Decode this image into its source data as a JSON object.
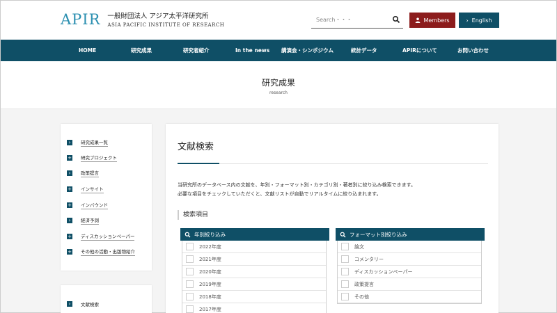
{
  "header": {
    "logo_mark": "APIR",
    "logo_jp": "一般財団法人 アジア太平洋研究所",
    "logo_en": "ASIA PACIFIC INSTITUTE OF RESEARCH",
    "search_placeholder": "Search・・・",
    "members_label": "Members",
    "english_label": "English"
  },
  "nav": {
    "items": [
      "HOME",
      "研究成果",
      "研究者紹介",
      "In the news",
      "講演会・シンポジウム",
      "統計データ",
      "APIRについて",
      "お問い合わせ"
    ]
  },
  "page": {
    "title": "研究成果",
    "subtitle": "research"
  },
  "sidebar": {
    "items": [
      {
        "label": "研究成果一覧",
        "icon": "›"
      },
      {
        "label": "研究プロジェクト",
        "icon": "+"
      },
      {
        "label": "政策提言",
        "icon": "›"
      },
      {
        "label": "インサイト",
        "icon": "+"
      },
      {
        "label": "インバウンド",
        "icon": "+"
      },
      {
        "label": "経済予測",
        "icon": "›"
      },
      {
        "label": "ディスカッションペーパー",
        "icon": "+"
      },
      {
        "label": "その他の活動・出版物紹介",
        "icon": "+"
      }
    ],
    "second_items": [
      {
        "label": "文献検索",
        "icon": "›"
      }
    ]
  },
  "main": {
    "title": "文献検索",
    "desc_line1": "当研究所のデータベース内の文献を、年別・フォーマット別・カテゴリ別・著者別に絞り込み検索できます。",
    "desc_line2": "必要な項目をチェックしていただくと、文献リストが自動でリアルタイムに絞り込まれます。",
    "section_title": "検索項目",
    "year_filter": {
      "title": "年別絞り込み",
      "options": [
        "2022年度",
        "2021年度",
        "2020年度",
        "2019年度",
        "2018年度",
        "2017年度"
      ]
    },
    "format_filter": {
      "title": "フォーマット別絞り込み",
      "options": [
        "論文",
        "コメンタリー",
        "ディスカッションペーパー",
        "政策提言",
        "その他"
      ]
    }
  },
  "colors": {
    "brand_teal": "#0f4f66",
    "logo_blue": "#2b8fb0",
    "members_red": "#8c1c1c"
  }
}
